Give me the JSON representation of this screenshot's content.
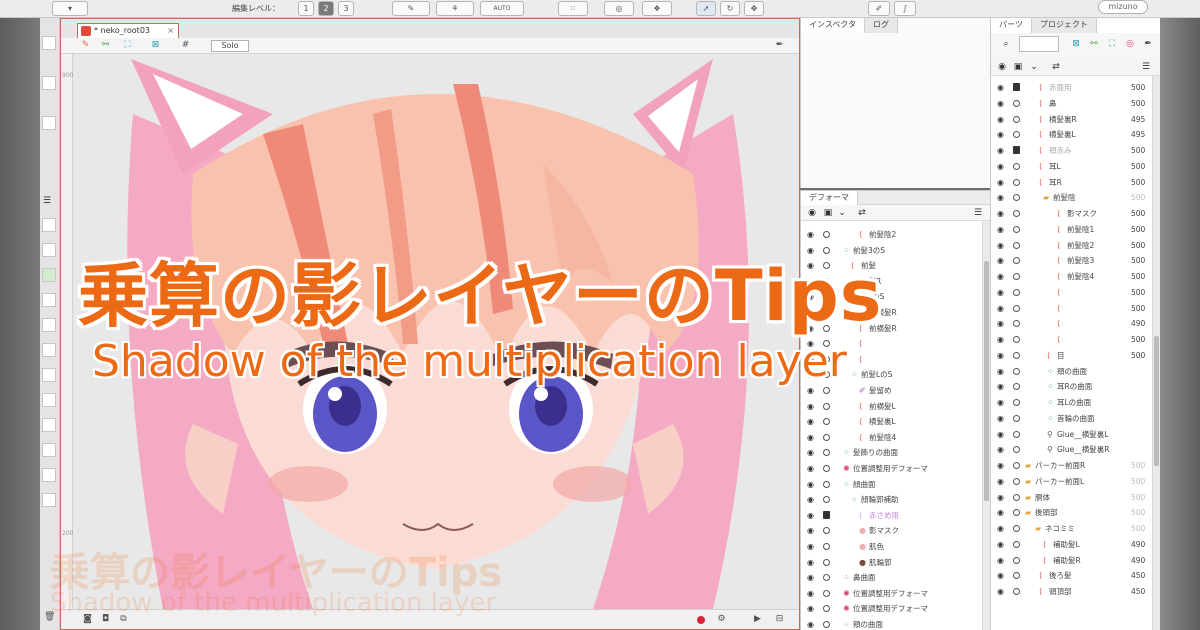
{
  "toolbar": {
    "level_label": "編集レベル：",
    "level_buttons": [
      "1",
      "2",
      "3"
    ],
    "auto_label": "AUTO",
    "brand": "mizuno"
  },
  "canvas": {
    "tab_title": "* neko_root03",
    "solo_label": "Solo",
    "ruler_top": "900",
    "ruler_mid": "200"
  },
  "inspector": {
    "tabs": [
      "インスペクタ",
      "ログ"
    ]
  },
  "deformer": {
    "title": "デフォーマ",
    "rows": [
      {
        "name": "前髪陰2",
        "type": "part",
        "indent": 68
      },
      {
        "name": "前髪3のS",
        "type": "warp",
        "indent": 52
      },
      {
        "name": "前髪",
        "type": "part",
        "indent": 60
      },
      {
        "name": "前髪R",
        "type": "folder",
        "indent": 60
      },
      {
        "name": "前髪LのS",
        "type": "warp",
        "indent": 52
      },
      {
        "name": "前横髪R",
        "type": "part",
        "indent": 68
      },
      {
        "name": "前横髪R",
        "type": "part",
        "indent": 68
      },
      {
        "name": "",
        "type": "part",
        "indent": 68
      },
      {
        "name": "",
        "type": "part",
        "indent": 68
      },
      {
        "name": "前髪LのS",
        "type": "warp",
        "indent": 60
      },
      {
        "name": "髪留め",
        "type": "pen",
        "indent": 68
      },
      {
        "name": "前横髪L",
        "type": "part",
        "indent": 68
      },
      {
        "name": "横髪裏L",
        "type": "part",
        "indent": 68
      },
      {
        "name": "前髪陰4",
        "type": "part",
        "indent": 68
      },
      {
        "name": "髪飾りの曲面",
        "type": "warp",
        "indent": 52
      },
      {
        "name": "位置調整用デフォーマ",
        "type": "rot",
        "indent": 52
      },
      {
        "name": "顔曲面",
        "type": "warp",
        "indent": 52
      },
      {
        "name": "顔輪郭補助",
        "type": "warp",
        "indent": 60
      },
      {
        "name": "赤さめ用",
        "type": "muted",
        "indent": 68
      },
      {
        "name": "影マスク",
        "type": "circle",
        "indent": 68
      },
      {
        "name": "肌色",
        "type": "circle",
        "indent": 68
      },
      {
        "name": "肌輪郭",
        "type": "brown",
        "indent": 68
      },
      {
        "name": "鼻曲面",
        "type": "warp",
        "indent": 52
      },
      {
        "name": "位置調整用デフォーマ",
        "type": "rot",
        "indent": 52
      },
      {
        "name": "位置調整用デフォーマ",
        "type": "rot",
        "indent": 52
      },
      {
        "name": "頬の曲面",
        "type": "warp",
        "indent": 52
      }
    ]
  },
  "parts": {
    "tabs": [
      "パーツ",
      "プロジェクト"
    ],
    "rows": [
      {
        "name": "赤面用",
        "val": "500",
        "indent": 58,
        "muted": true
      },
      {
        "name": "鼻",
        "val": "500",
        "indent": 58
      },
      {
        "name": "横髪裏R",
        "val": "495",
        "indent": 58
      },
      {
        "name": "横髪裏L",
        "val": "495",
        "indent": 58
      },
      {
        "name": "頬赤み",
        "val": "500",
        "indent": 58,
        "muted": true
      },
      {
        "name": "耳L",
        "val": "500",
        "indent": 58
      },
      {
        "name": "耳R",
        "val": "500",
        "indent": 58
      },
      {
        "name": "前髪陰",
        "val": "500",
        "indent": 62,
        "folder": true
      },
      {
        "name": "影マスク",
        "val": "500",
        "indent": 76
      },
      {
        "name": "前髪陰1",
        "val": "500",
        "indent": 76
      },
      {
        "name": "前髪陰2",
        "val": "500",
        "indent": 76
      },
      {
        "name": "前髪陰3",
        "val": "500",
        "indent": 76
      },
      {
        "name": "前髪陰4",
        "val": "500",
        "indent": 76
      },
      {
        "name": "",
        "val": "500",
        "indent": 76
      },
      {
        "name": "",
        "val": "500",
        "indent": 76
      },
      {
        "name": "",
        "val": "490",
        "indent": 76
      },
      {
        "name": "",
        "val": "500",
        "indent": 76
      },
      {
        "name": "目",
        "val": "500",
        "indent": 66
      },
      {
        "name": "頬の曲面",
        "val": "",
        "indent": 66,
        "green": true
      },
      {
        "name": "耳Rの曲面",
        "val": "",
        "indent": 66,
        "green": true
      },
      {
        "name": "耳Lの曲面",
        "val": "",
        "indent": 66,
        "green": true
      },
      {
        "name": "首輪の曲面",
        "val": "",
        "indent": 66,
        "green": true
      },
      {
        "name": "Glue__横髪裏L",
        "val": "",
        "indent": 66,
        "pin": true
      },
      {
        "name": "Glue__横髪裏R",
        "val": "",
        "indent": 66,
        "pin": true
      },
      {
        "name": "パーカー前面R",
        "val": "500",
        "indent": 44,
        "folder": true
      },
      {
        "name": "パーカー前面L",
        "val": "500",
        "indent": 44,
        "folder": true
      },
      {
        "name": "胴体",
        "val": "500",
        "indent": 44,
        "folder": true
      },
      {
        "name": "後頭部",
        "val": "500",
        "indent": 44,
        "folder": true
      },
      {
        "name": "ネコミミ",
        "val": "500",
        "indent": 54,
        "folder": true
      },
      {
        "name": "補助髪L",
        "val": "490",
        "indent": 62
      },
      {
        "name": "補助髪R",
        "val": "490",
        "indent": 62
      },
      {
        "name": "後ろ髪",
        "val": "450",
        "indent": 58
      },
      {
        "name": "頭頂部",
        "val": "450",
        "indent": 58
      }
    ]
  },
  "overlay": {
    "title": "乗算の影レイヤーのTips",
    "subtitle": "Shadow of the multiplication layer"
  },
  "colors": {
    "accent_orange": "#ec6a16",
    "hair_pink": "#f3a6c3",
    "skin": "#fbdcd4",
    "shadow": "#f4a08c",
    "eye": "#5a56c8"
  }
}
